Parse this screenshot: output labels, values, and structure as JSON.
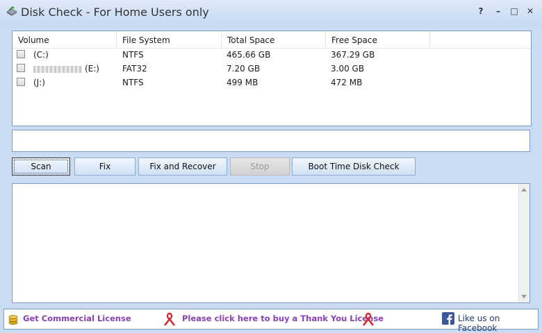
{
  "window": {
    "title": "Disk Check - For Home Users only",
    "help": "?",
    "minimize": "–",
    "maximize": "□",
    "close": "✕"
  },
  "drive_list": {
    "columns": [
      "Volume",
      "File System",
      "Total Space",
      "Free Space"
    ],
    "rows": [
      {
        "volume": "(C:)",
        "fs": "NTFS",
        "total": "465.66 GB",
        "free": "367.29 GB",
        "checked": false
      },
      {
        "volume": "(E:)",
        "fs": "FAT32",
        "total": "7.20 GB",
        "free": "3.00 GB",
        "checked": false
      },
      {
        "volume": "(J:)",
        "fs": "NTFS",
        "total": "499 MB",
        "free": "472 MB",
        "checked": false
      }
    ]
  },
  "path_field": {
    "value": ""
  },
  "buttons": {
    "scan": "Scan",
    "fix": "Fix",
    "fix_recover": "Fix and Recover",
    "stop": "Stop",
    "boot_check": "Boot Time Disk Check"
  },
  "footer": {
    "commercial": "Get Commercial License",
    "thank_you": "Please click here to buy a Thank You License",
    "facebook": "Like us on Facebook"
  },
  "colors": {
    "accent": "#8b3fb8",
    "ribbon": "#d8262c",
    "facebook": "#3b5998",
    "border": "#7a9cc9"
  }
}
